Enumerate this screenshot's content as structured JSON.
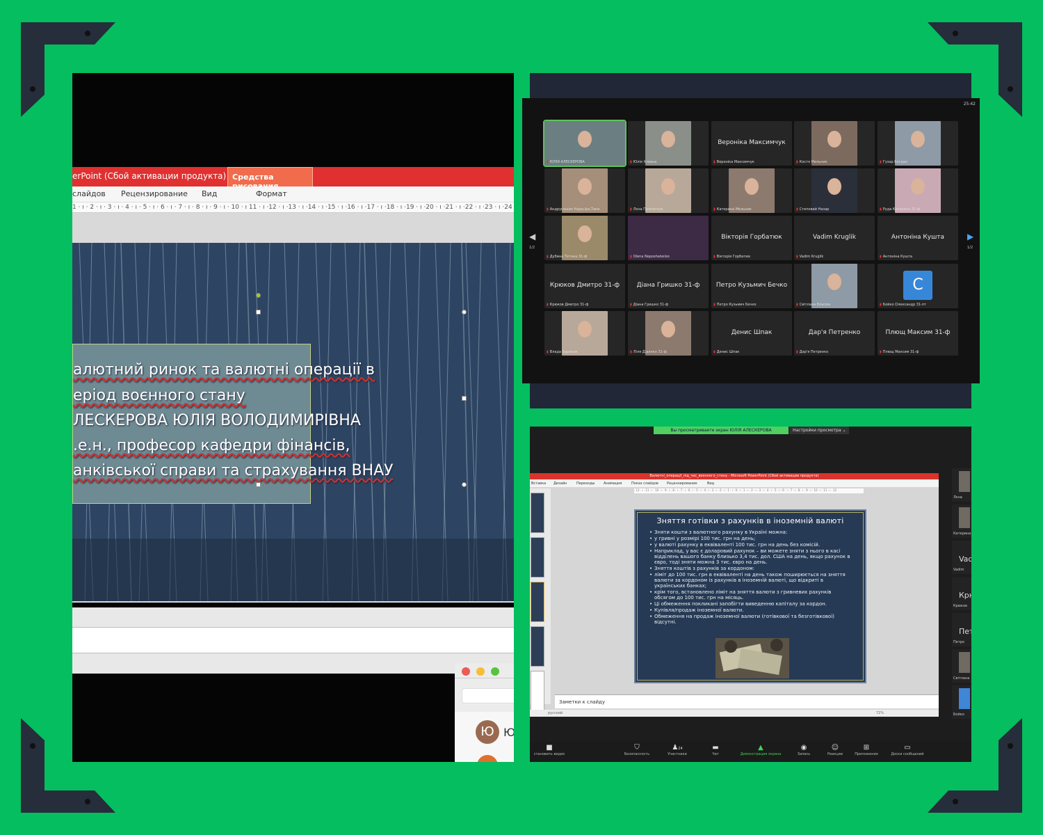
{
  "colors": {
    "background": "#05be5f",
    "accent_red": "#e03030",
    "zoom_green": "#4fd060",
    "slide_blue": "#263a55"
  },
  "ppt_window": {
    "title_fragment": "erPoint (Сбой активации продукта)",
    "contextual_tab": "Средства рисования",
    "menu": [
      "слайдов",
      "Рецензирование",
      "Вид",
      "Формат"
    ],
    "ruler": "1 · ı · 2 · ı · 3 · ı · 4 · ı · 5 · ı · 6 · ı · 7 · ı · 8 · ı · 9 · ı · 10 · ı 11 · ı ·12 · ı ·13 · ı ·14 · ı ·15 · ı ·16 · ı ·17 · ı ·18 · ı ·19 · ı ·20 · ı ·21 · ı ·22 · ı ·23 · ı ·24",
    "slide_lines": [
      "алютний ринок та валютні операції в",
      "еріод воєнного стану",
      "ЛЕСКЕРОВА ЮЛІЯ ВОЛОДИМИРІВНА",
      ".е.н., професор кафедри фінансів,",
      "анківської справи та страхування ВНАУ"
    ],
    "chat_avatar_letter": "Ю",
    "chat_avatar_text": "Ю"
  },
  "zoom_gallery": {
    "clock": "25:42",
    "page": "1/2",
    "tiles": [
      {
        "big": "",
        "name": "ЮЛІЯ АЛЕСКЕРОВА",
        "video": true
      },
      {
        "big": "",
        "name": "Юлія Хлевна",
        "video": true
      },
      {
        "big": "Вероніка Максимчук",
        "name": "Вероніка Максимчук",
        "video": false
      },
      {
        "big": "",
        "name": "Костя Мельник",
        "video": true
      },
      {
        "big": "",
        "name": "Гузар Богдан",
        "video": true
      },
      {
        "big": "",
        "name": "Андрусишин Надя,Іра,Таня",
        "video": true
      },
      {
        "big": "",
        "name": "Лєна Прокопчук",
        "video": true
      },
      {
        "big": "",
        "name": "Катерина Мельник",
        "video": true
      },
      {
        "big": "",
        "name": "Степовий Назар",
        "video": true
      },
      {
        "big": "",
        "name": "Руда Катерина 31-ф",
        "video": true
      },
      {
        "big": "",
        "name": "Дубина Тетяна 31-ф",
        "video": true
      },
      {
        "big": "",
        "name": "Olena Neposhatenko",
        "video": true
      },
      {
        "big": "Вікторія Горбатюк",
        "name": "Вікторія Горбатюк",
        "video": false
      },
      {
        "big": "Vadim Kruglik",
        "name": "Vadim Kruglik",
        "video": false
      },
      {
        "big": "Антоніна Кушта",
        "name": "Антоніна Кушта",
        "video": false
      },
      {
        "big": "Крюков Дмитро 31-ф",
        "name": "Крюков Дмитро 31-ф",
        "video": false
      },
      {
        "big": "Діана Гришко 31-ф",
        "name": "Діана Гришко 31-ф",
        "video": false
      },
      {
        "big": "Петро Кузьмич Бечко",
        "name": "Петро Кузьмич Бечко",
        "video": false
      },
      {
        "big": "",
        "name": "Світлана Власюк",
        "video": true
      },
      {
        "big": "",
        "name": "Бойко Олександр 31-пт",
        "video": false,
        "avatar": "С"
      },
      {
        "big": "",
        "name": "Влада Бараник",
        "video": true
      },
      {
        "big": "",
        "name": "Ліля Діденко 31-ф",
        "video": true
      },
      {
        "big": "Денис Шпак",
        "name": "Денис Шпак",
        "video": false
      },
      {
        "big": "Дар'я Петренко",
        "name": "Дар'я Петренко",
        "video": false
      },
      {
        "big": "Плющ Максим 31-ф",
        "name": "Плющ Максим 31-ф",
        "video": false
      }
    ]
  },
  "zoom_share": {
    "banner": "Вы просматриваете экран ЮЛІЯ АЛЕСКЕРОВА",
    "view_options": "Настройки просмотра",
    "ppt_title": "Валютні_операції_під_час_воєнного_стану - Microsoft PowerPoint (Сбой активации продукта)",
    "ppt_menu": [
      "Вставка",
      "Дизайн",
      "Переходы",
      "Анимация",
      "Показ слайдов",
      "Рецензирование",
      "Вид"
    ],
    "ruler": "· 12 · ı · 11 · ı · 10 · ı · 9 · ı · 8 · ı · 7 · ı · 6 · ı · 5 · ı · 4 · ı · 3 · ı · 2 · ı · 1 · ı · 0 · ı · 1 · ı · 2 · ı · 3 · ı · 4 · ı · 5 · ı · 6 · ı · 7 · ı · 8 · ı · 9 · ı · 10 · ı · 11 · ı · 12",
    "slide_title": "Зняття готівки з рахунків в іноземній валюті",
    "bullets": [
      "Зняти кошти з валютного рахунку в Україні можна:",
      "у гривні у розмірі 100 тис. грн на день;",
      "у валюті рахунку в еквіваленті 100 тис. грн на день без комісій.",
      "Наприклад, у вас є доларовий рахунок – ви можете зняти з нього в касі відділень вашого банку близько 3,4 тис. дол. США на день, якщо рахунок в євро, тоді зняти можна 3 тис. євро на день.",
      "Зняття коштів з рахунків за кордоном:",
      "ліміт до 100 тис. грн в еквіваленті на день також поширюється на зняття валюти за кордоном із рахунків в іноземній валюті, що відкриті в українських банках;",
      "крім того, встановлено ліміт на зняття валюти з гривневих рахунків обсягом до 100 тис. грн на місяць.",
      "Ці обмеження покликані запобігти виведенню капіталу за кордон.",
      "Купівля/продаж іноземної валюти.",
      "Обмеження на продаж іноземної валюти (готівкової та безготівкової) відсутні."
    ],
    "notes": "Заметки к слайду",
    "status_lang": "русский",
    "zoom_level": "72%",
    "side": [
      {
        "big": "",
        "name": "Лєна"
      },
      {
        "big": "",
        "name": "Катерина"
      },
      {
        "big": "Vad",
        "name": "Vadim"
      },
      {
        "big": "Крю",
        "name": "Крюков"
      },
      {
        "big": "Петр",
        "name": "Петро"
      },
      {
        "big": "",
        "name": "Світлана"
      },
      {
        "big": "",
        "name": "Бойко"
      }
    ],
    "toolbar": [
      {
        "icon": "video-icon",
        "label": "становить видео"
      },
      {
        "icon": "security-icon",
        "label": "Безопасность"
      },
      {
        "icon": "participants-icon",
        "label": "Участники",
        "count": "24"
      },
      {
        "icon": "chat-icon",
        "label": "Чат"
      },
      {
        "icon": "share-screen-icon",
        "label": "Демонстрация экрана"
      },
      {
        "icon": "record-icon",
        "label": "Запись"
      },
      {
        "icon": "reactions-icon",
        "label": "Реакции"
      },
      {
        "icon": "apps-icon",
        "label": "Приложения"
      },
      {
        "icon": "whiteboard-icon",
        "label": "Доски сообщений"
      }
    ]
  }
}
